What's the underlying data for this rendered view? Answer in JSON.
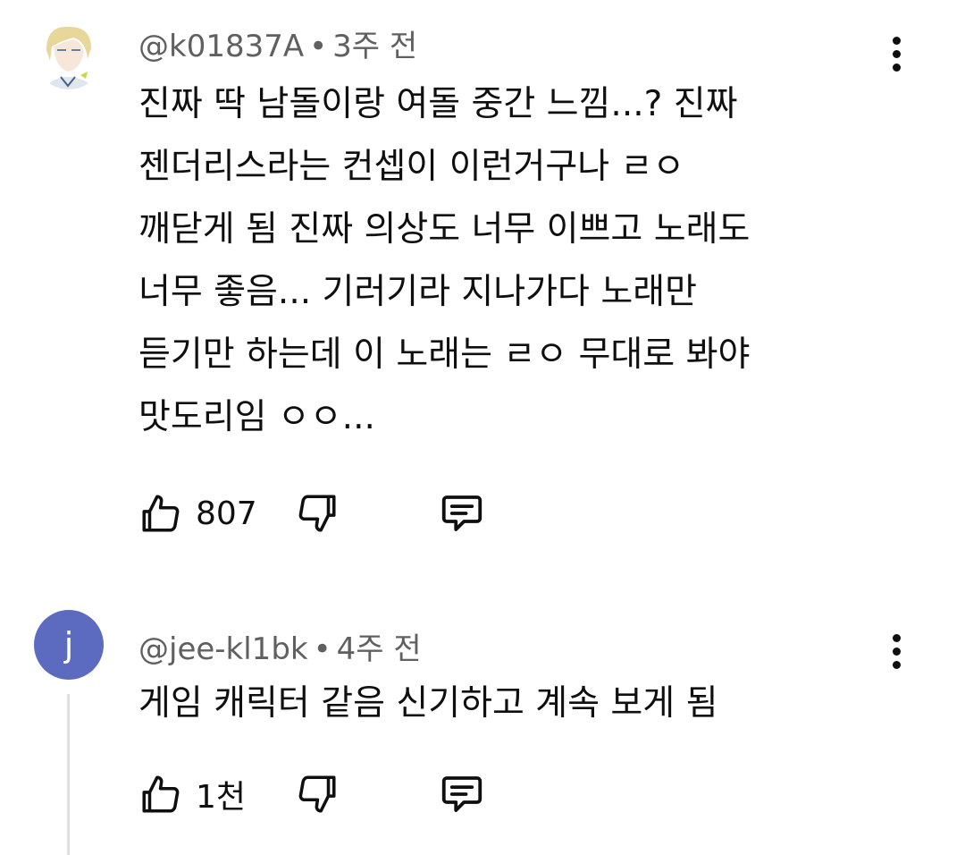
{
  "comments": [
    {
      "author": "@k01837A",
      "time": "3주 전",
      "avatar_icon": "illustrated-character-avatar",
      "lines": [
        "진짜 딱 남돌이랑 여돌 중간 느낌...? 진짜",
        "젠더리스라는 컨셉이 이런거구나 ㄹㅇ",
        "깨닫게 됨 진짜 의상도 너무 이쁘고 노래도",
        "너무 좋음... 기러기라 지나가다 노래만",
        "듣기만 하는데 이 노래는 ㄹㅇ 무대로 봐야",
        "맛도리임 ㅇㅇ..."
      ],
      "likes": "807"
    },
    {
      "author": "@jee-kl1bk",
      "time": "4주 전",
      "avatar_letter": "j",
      "avatar_color": "#5c6bc0",
      "lines": [
        "게임 캐릭터 같음 신기하고 계속 보게 됨"
      ],
      "likes": "1천"
    }
  ],
  "separator": "•",
  "icons": [
    "thumbs-up-icon",
    "thumbs-down-icon",
    "reply-icon",
    "more-vert-icon"
  ]
}
